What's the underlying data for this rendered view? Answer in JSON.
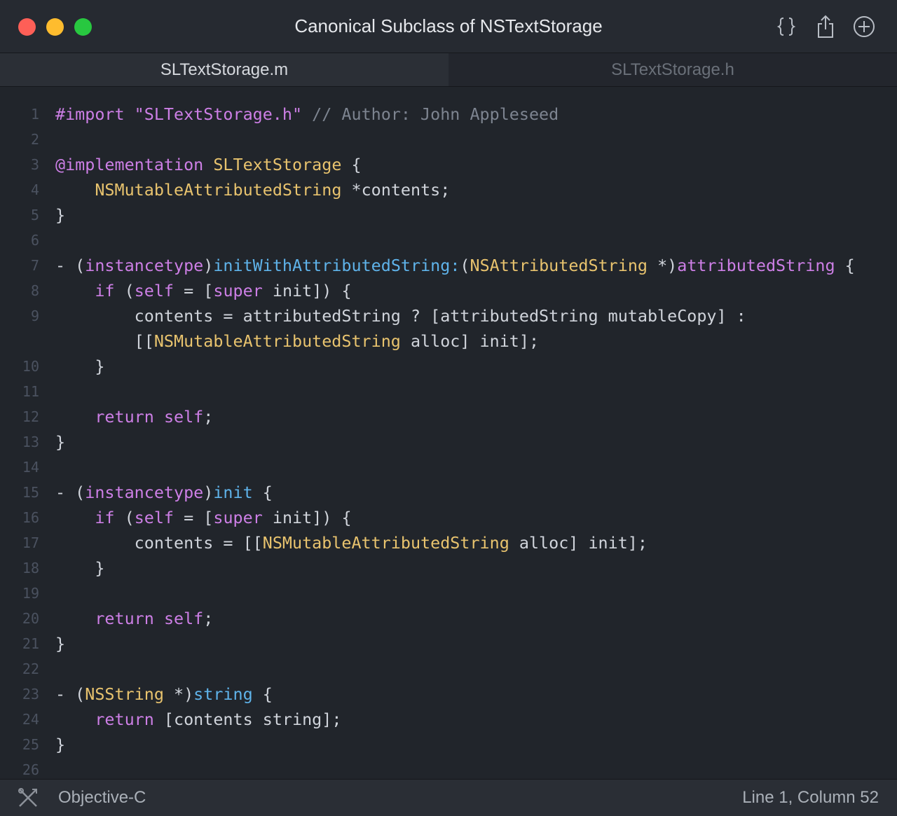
{
  "window": {
    "title": "Canonical Subclass of NSTextStorage",
    "toolbar_icons": [
      "braces-icon",
      "share-icon",
      "add-icon"
    ]
  },
  "tabs": [
    {
      "label": "SLTextStorage.m",
      "active": true
    },
    {
      "label": "SLTextStorage.h",
      "active": false
    }
  ],
  "editor": {
    "lines": [
      {
        "n": "1",
        "tokens": [
          [
            "st",
            "#import \"SLTextStorage.h\""
          ],
          [
            "pl",
            " "
          ],
          [
            "cm",
            "// Author: John Appleseed"
          ]
        ]
      },
      {
        "n": "2",
        "tokens": []
      },
      {
        "n": "3",
        "tokens": [
          [
            "kw",
            "@implementation"
          ],
          [
            "pl",
            " "
          ],
          [
            "ty",
            "SLTextStorage"
          ],
          [
            "pl",
            " {"
          ]
        ]
      },
      {
        "n": "4",
        "tokens": [
          [
            "pl",
            "    "
          ],
          [
            "ty",
            "NSMutableAttributedString"
          ],
          [
            "pl",
            " *contents;"
          ]
        ]
      },
      {
        "n": "5",
        "tokens": [
          [
            "pl",
            "}"
          ]
        ]
      },
      {
        "n": "6",
        "tokens": []
      },
      {
        "n": "7",
        "tokens": [
          [
            "pl",
            "- ("
          ],
          [
            "kw",
            "instancetype"
          ],
          [
            "pl",
            ")"
          ],
          [
            "fn",
            "initWithAttributedString:"
          ],
          [
            "pl",
            "("
          ],
          [
            "ty",
            "NSAttributedString"
          ],
          [
            "pl",
            " *)"
          ],
          [
            "kw",
            "attributedString"
          ],
          [
            "pl",
            " {"
          ]
        ]
      },
      {
        "n": "8",
        "tokens": [
          [
            "pl",
            "    "
          ],
          [
            "kw",
            "if"
          ],
          [
            "pl",
            " ("
          ],
          [
            "kw",
            "self"
          ],
          [
            "pl",
            " = ["
          ],
          [
            "kw",
            "super"
          ],
          [
            "pl",
            " init]) {"
          ]
        ]
      },
      {
        "n": "9",
        "tokens": [
          [
            "pl",
            "        contents = attributedString ? [attributedString mutableCopy] :"
          ]
        ]
      },
      {
        "n": "",
        "tokens": [
          [
            "pl",
            "        [["
          ],
          [
            "ty",
            "NSMutableAttributedString"
          ],
          [
            "pl",
            " alloc] init];"
          ]
        ]
      },
      {
        "n": "10",
        "tokens": [
          [
            "pl",
            "    }"
          ]
        ]
      },
      {
        "n": "11",
        "tokens": []
      },
      {
        "n": "12",
        "tokens": [
          [
            "pl",
            "    "
          ],
          [
            "kw",
            "return"
          ],
          [
            "pl",
            " "
          ],
          [
            "kw",
            "self"
          ],
          [
            "pl",
            ";"
          ]
        ]
      },
      {
        "n": "13",
        "tokens": [
          [
            "pl",
            "}"
          ]
        ]
      },
      {
        "n": "14",
        "tokens": []
      },
      {
        "n": "15",
        "tokens": [
          [
            "pl",
            "- ("
          ],
          [
            "kw",
            "instancetype"
          ],
          [
            "pl",
            ")"
          ],
          [
            "fn",
            "init"
          ],
          [
            "pl",
            " {"
          ]
        ]
      },
      {
        "n": "16",
        "tokens": [
          [
            "pl",
            "    "
          ],
          [
            "kw",
            "if"
          ],
          [
            "pl",
            " ("
          ],
          [
            "kw",
            "self"
          ],
          [
            "pl",
            " = ["
          ],
          [
            "kw",
            "super"
          ],
          [
            "pl",
            " init]) {"
          ]
        ]
      },
      {
        "n": "17",
        "tokens": [
          [
            "pl",
            "        contents = [["
          ],
          [
            "ty",
            "NSMutableAttributedString"
          ],
          [
            "pl",
            " alloc] init];"
          ]
        ]
      },
      {
        "n": "18",
        "tokens": [
          [
            "pl",
            "    }"
          ]
        ]
      },
      {
        "n": "19",
        "tokens": []
      },
      {
        "n": "20",
        "tokens": [
          [
            "pl",
            "    "
          ],
          [
            "kw",
            "return"
          ],
          [
            "pl",
            " "
          ],
          [
            "kw",
            "self"
          ],
          [
            "pl",
            ";"
          ]
        ]
      },
      {
        "n": "21",
        "tokens": [
          [
            "pl",
            "}"
          ]
        ]
      },
      {
        "n": "22",
        "tokens": []
      },
      {
        "n": "23",
        "tokens": [
          [
            "pl",
            "- ("
          ],
          [
            "ty",
            "NSString"
          ],
          [
            "pl",
            " *)"
          ],
          [
            "fn",
            "string"
          ],
          [
            "pl",
            " {"
          ]
        ]
      },
      {
        "n": "24",
        "tokens": [
          [
            "pl",
            "    "
          ],
          [
            "kw",
            "return"
          ],
          [
            "pl",
            " [contents string];"
          ]
        ]
      },
      {
        "n": "25",
        "tokens": [
          [
            "pl",
            "}"
          ]
        ]
      },
      {
        "n": "26",
        "tokens": []
      }
    ]
  },
  "statusbar": {
    "language": "Objective-C",
    "language_icon": "tools-icon",
    "position": "Line 1, Column 52"
  },
  "colors": {
    "keyword": "#cd7fe6",
    "type": "#e8c36e",
    "function": "#5fb3ea",
    "comment": "#7d8490",
    "plain": "#d0d4db",
    "background": "#21252b"
  }
}
